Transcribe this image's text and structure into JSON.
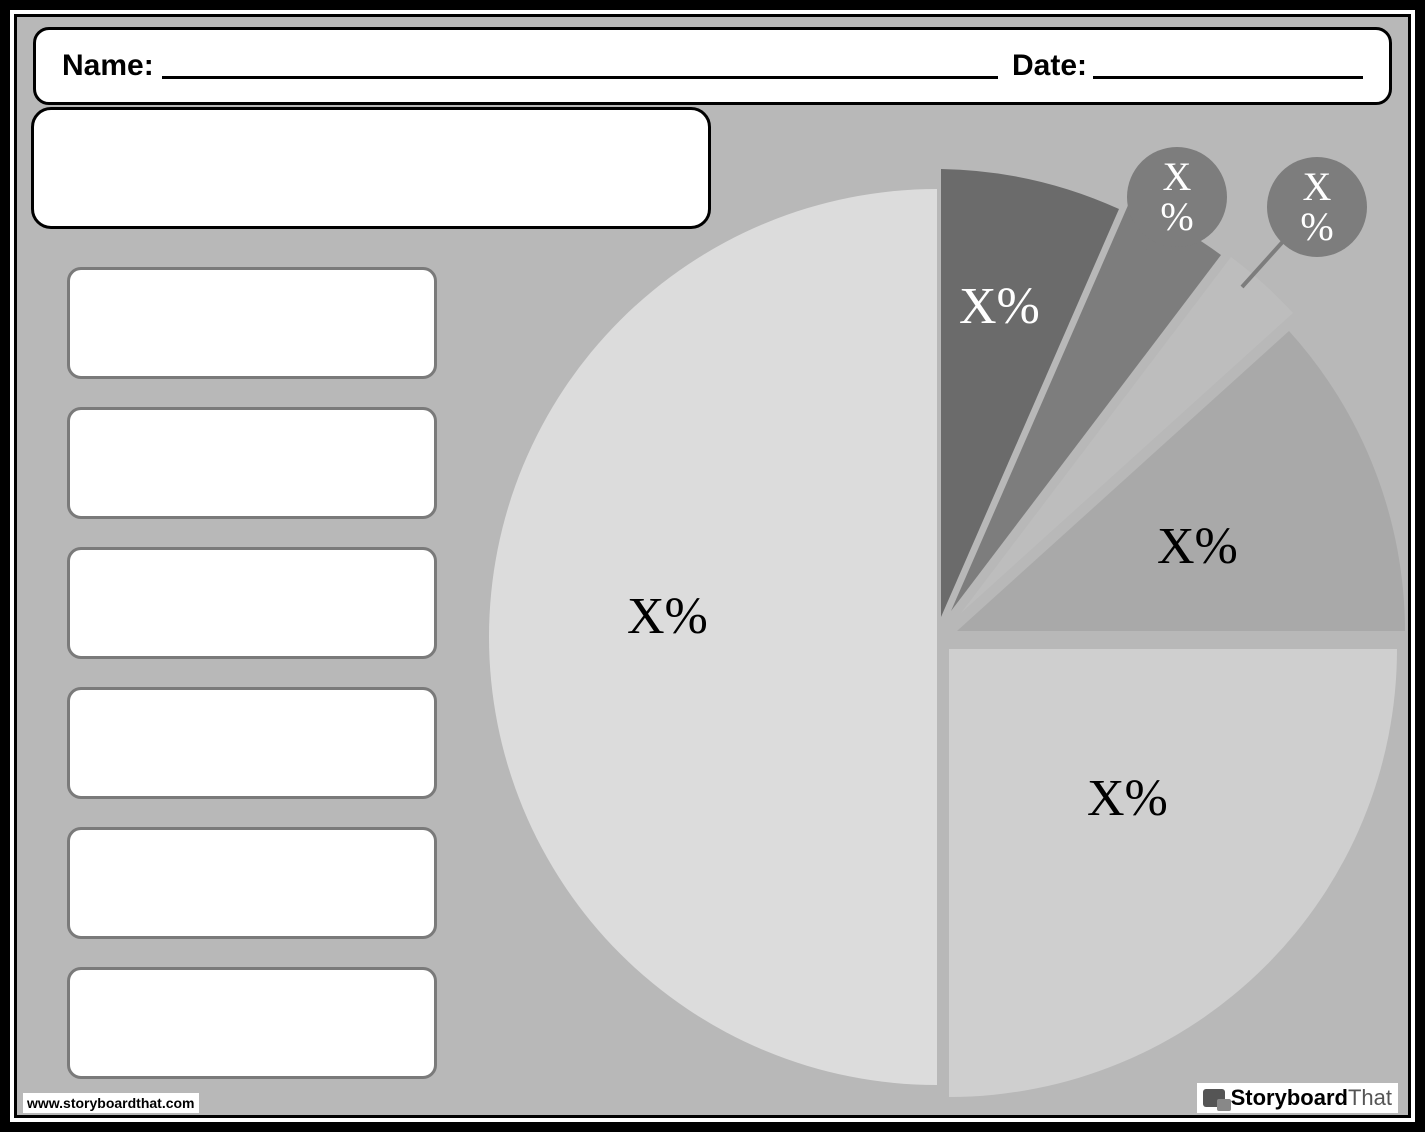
{
  "header": {
    "name_label": "Name:",
    "date_label": "Date:"
  },
  "legend": {
    "items": [
      "",
      "",
      "",
      "",
      "",
      ""
    ]
  },
  "chart_data": {
    "type": "pie",
    "title": "",
    "series": [
      {
        "name": "",
        "value": "X%",
        "color": "#dcdcdc"
      },
      {
        "name": "",
        "value": "X%",
        "color": "#cfcfcf"
      },
      {
        "name": "",
        "value": "X%",
        "color": "#a9a9a9"
      },
      {
        "name": "",
        "value": "X%",
        "color": "#bdbdbd",
        "callout": true
      },
      {
        "name": "",
        "value": "X%",
        "color": "#7d7d7d",
        "callout": true
      },
      {
        "name": "",
        "value": "X%",
        "color": "#6b6b6b"
      }
    ],
    "callout_badges": [
      "X%",
      "X%"
    ]
  },
  "footer": {
    "url": "www.storyboardthat.com",
    "brand_bold": "Storyboard",
    "brand_light": "That"
  }
}
